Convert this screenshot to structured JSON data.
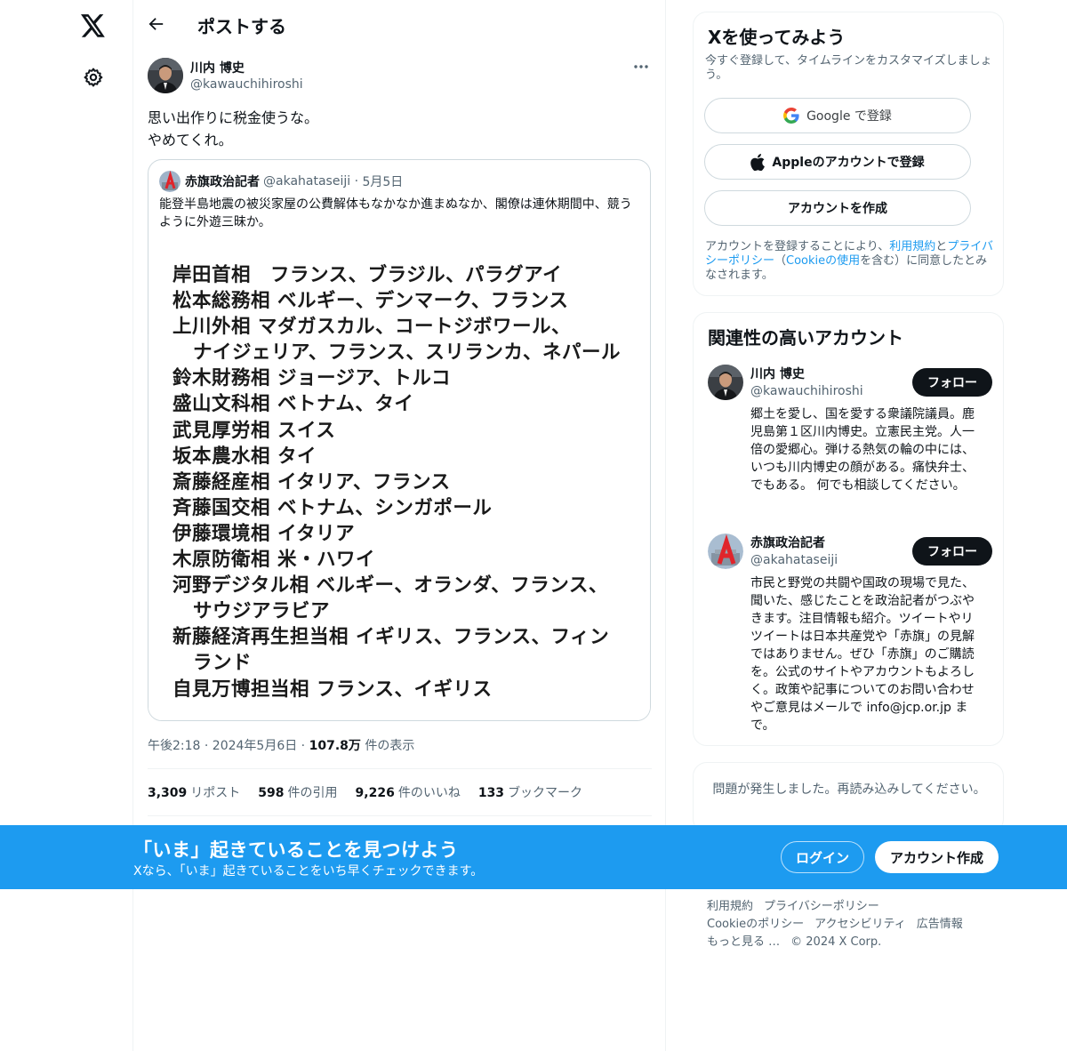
{
  "header": {
    "title": "ポストする"
  },
  "tweet": {
    "author_name": "川内 博史",
    "author_handle": "@kawauchihiroshi",
    "text": "思い出作りに税金使うな。\nやめてくれ。",
    "timestamp": "午後2:18 · 2024年5月6日 · ",
    "views": "107.8万",
    "views_label": "件の表示",
    "stats": [
      {
        "value": "3,309",
        "label": "リポスト"
      },
      {
        "value": "598",
        "label": "件の引用"
      },
      {
        "value": "9,226",
        "label": "件のいいね"
      },
      {
        "value": "133",
        "label": "ブックマーク"
      }
    ]
  },
  "quote": {
    "name": "赤旗政治記者",
    "handle": "@akahataseiji",
    "date": "5月5日",
    "text": "能登半島地震の被災家屋の公費解体もなかなか進まぬなか、閣僚は連休期間中、競うように外遊三昧か。",
    "image_lines": [
      {
        "text": "岸田首相　フランス、ブラジル、パラグアイ",
        "indent": false
      },
      {
        "text": "松本総務相  ベルギー、デンマーク、フランス",
        "indent": false
      },
      {
        "text": "上川外相  マダガスカル、コートジボワール、",
        "indent": false
      },
      {
        "text": "ナイジェリア、フランス、スリランカ、ネパール",
        "indent": true
      },
      {
        "text": "鈴木財務相  ジョージア、トルコ",
        "indent": false
      },
      {
        "text": "盛山文科相  ベトナム、タイ",
        "indent": false
      },
      {
        "text": "武見厚労相  スイス",
        "indent": false
      },
      {
        "text": "坂本農水相  タイ",
        "indent": false
      },
      {
        "text": "斎藤経産相  イタリア、フランス",
        "indent": false
      },
      {
        "text": "斉藤国交相  ベトナム、シンガポール",
        "indent": false
      },
      {
        "text": "伊藤環境相  イタリア",
        "indent": false
      },
      {
        "text": "木原防衛相  米・ハワイ",
        "indent": false
      },
      {
        "text": "河野デジタル相  ベルギー、オランダ、フランス、",
        "indent": false
      },
      {
        "text": "サウジアラビア",
        "indent": true
      },
      {
        "text": "新藤経済再生担当相  イギリス、フランス、フィン",
        "indent": false
      },
      {
        "text": "ランド",
        "indent": true
      },
      {
        "text": "自見万博担当相  フランス、イギリス",
        "indent": false
      }
    ]
  },
  "signup_card": {
    "title": "Xを使ってみよう",
    "subtitle": "今すぐ登録して、タイムラインをカスタマイズしましょう。",
    "google_label": "Google で登録",
    "apple_label": "Appleのアカウントで登録",
    "create_label": "アカウントを作成",
    "legal_prefix": "アカウントを登録することにより、",
    "terms_link": "利用規約",
    "legal_and": "と",
    "privacy_link": "プライバシーポリシー",
    "legal_paren_open": "（",
    "cookie_link": "Cookieの使用",
    "legal_suffix": "を含む）に同意したとみなされます。"
  },
  "relevant": {
    "title": "関連性の高いアカウント",
    "accounts": [
      {
        "name": "川内 博史",
        "handle": "@kawauchihiroshi",
        "follow_label": "フォロー",
        "bio": "郷土を愛し、国を愛する衆議院議員。鹿児島第１区川内博史。立憲民主党。人一倍の愛郷心。弾ける熱気の輪の中には、いつも川内博史の顔がある。痛快弁士、でもある。 何でも相談してください。"
      },
      {
        "name": "赤旗政治記者",
        "handle": "@akahataseiji",
        "follow_label": "フォロー",
        "bio": "市民と野党の共闘や国政の現場で見た、聞いた、感じたことを政治記者がつぶやきます。注目情報も紹介。ツイートやリツイートは日本共産党や「赤旗」の見解ではありません。ぜひ「赤旗」のご購読を。公式のサイトやアカウントもよろしく。政策や記事についてのお問い合わせやご意見はメールで info@jcp.or.jp まで。"
      }
    ]
  },
  "error_card": {
    "text": "問題が発生しました。再読み込みしてください。"
  },
  "footer": {
    "links": [
      "利用規約",
      "プライバシーポリシー",
      "Cookieのポリシー",
      "アクセシビリティ",
      "広告情報",
      "もっと見る …",
      "© 2024 X Corp."
    ]
  },
  "banner": {
    "title": "「いま」起きていることを見つけよう",
    "subtitle": "Xなら、「いま」起きていることをいち早くチェックできます。",
    "login_label": "ログイン",
    "signup_label": "アカウント作成"
  },
  "colors": {
    "accent": "#1d9bf0",
    "text": "#0f1419",
    "muted": "#536471",
    "border": "#eff3f4"
  },
  "icons": {
    "logo": "x-logo-icon",
    "settings": "gear-icon",
    "back": "back-arrow-icon",
    "more": "more-icon",
    "google": "google-icon",
    "apple": "apple-icon"
  }
}
